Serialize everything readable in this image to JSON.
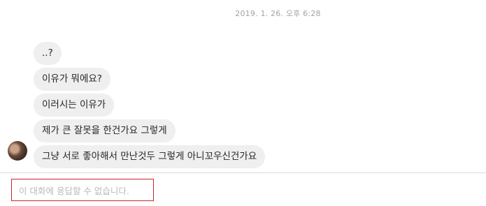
{
  "thread": {
    "timestamp": "2019. 1. 26. 오후 6:28",
    "messages": [
      {
        "text": "..?"
      },
      {
        "text": "이유가 뭐에요?"
      },
      {
        "text": "이러시는 이유가"
      },
      {
        "text": "제가 큰 잘못을 한건가요 그렇게"
      },
      {
        "text": "그냥 서로 좋아해서 만난것두 그렇게 아니꼬우신건가요"
      }
    ]
  },
  "composer": {
    "disabled_notice": "이 대화에 응답할 수 없습니다."
  }
}
